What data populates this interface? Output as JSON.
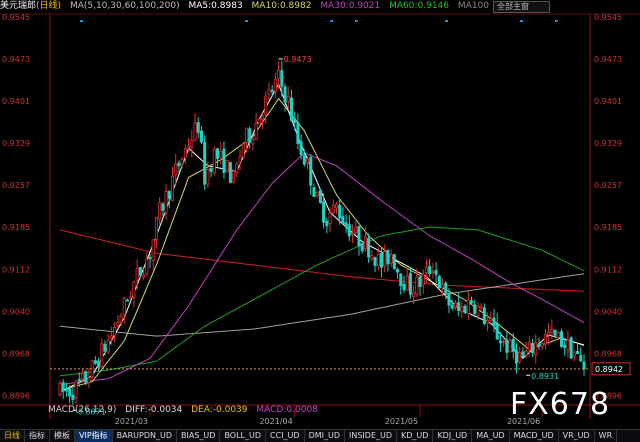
{
  "header": {
    "pair": "美元瑞郎",
    "period": "日线",
    "ma_params": "MA(5,10,30,60,100,200)",
    "ma5": "MA5:0.8983",
    "ma10": "MA10:0.8982",
    "ma30": "MA30:0.9021",
    "ma60": "MA60:0.9146",
    "ma100": "MA100",
    "selector": "全部主窗"
  },
  "macd_header": {
    "name": "MACD(26,12,9)",
    "diff": "DIFF:-0.0034",
    "dea": "DEA:-0.0039",
    "macd": "MACD:0.0008"
  },
  "toolbar": {
    "tabs": [
      "日线",
      "指标",
      "模板",
      "VIP指标",
      "BARUPDN_UD",
      "BIAS_UD",
      "BOLL_UD",
      "CCI_UD",
      "DMI_UD",
      "INSIDE_UD",
      "KD_UD",
      "KDJ_UD",
      "MA_UD",
      "MACD_UD",
      "VR_UD",
      "WR"
    ]
  },
  "watermark": "FX678",
  "chart_data": {
    "type": "candlestick",
    "y_ticks": [
      "0.9545",
      "0.9473",
      "0.9401",
      "0.9329",
      "0.9257",
      "0.9185",
      "0.9112",
      "0.9040",
      "0.8968",
      "0.8896"
    ],
    "ylim": [
      0.888,
      0.955
    ],
    "x_labels": [
      "2021/03",
      "2021/04",
      "2021/05",
      "2021/06"
    ],
    "x_label_candle_index": [
      28,
      73,
      112,
      150
    ],
    "annotations": {
      "high": {
        "label": "0.9473",
        "value": 0.9473,
        "candle": 68
      },
      "low_left": {
        "label": "0.8871",
        "value": 0.8871,
        "candle": 4
      },
      "low_right": {
        "label": "0.8931",
        "value": 0.8931,
        "candle": 145
      }
    },
    "current_price": {
      "label": "0.8942",
      "value": 0.8942
    },
    "candle_count": 164,
    "anchors": [
      [
        0,
        0.8902
      ],
      [
        4,
        0.8905
      ],
      [
        8,
        0.8925
      ],
      [
        12,
        0.896
      ],
      [
        16,
        0.9
      ],
      [
        20,
        0.905
      ],
      [
        24,
        0.91
      ],
      [
        28,
        0.914
      ],
      [
        31,
        0.921
      ],
      [
        34,
        0.925
      ],
      [
        36,
        0.928
      ],
      [
        40,
        0.933
      ],
      [
        43,
        0.936
      ],
      [
        45,
        0.927
      ],
      [
        48,
        0.931
      ],
      [
        51,
        0.9295
      ],
      [
        54,
        0.9265
      ],
      [
        57,
        0.933
      ],
      [
        60,
        0.935
      ],
      [
        63,
        0.939
      ],
      [
        66,
        0.942
      ],
      [
        68,
        0.944
      ],
      [
        71,
        0.94
      ],
      [
        74,
        0.933
      ],
      [
        77,
        0.929
      ],
      [
        80,
        0.923
      ],
      [
        83,
        0.92
      ],
      [
        86,
        0.922
      ],
      [
        89,
        0.919
      ],
      [
        92,
        0.917
      ],
      [
        96,
        0.915
      ],
      [
        100,
        0.912
      ],
      [
        103,
        0.914
      ],
      [
        106,
        0.91
      ],
      [
        109,
        0.908
      ],
      [
        112,
        0.909
      ],
      [
        116,
        0.912
      ],
      [
        120,
        0.906
      ],
      [
        124,
        0.904
      ],
      [
        128,
        0.906
      ],
      [
        132,
        0.903
      ],
      [
        136,
        0.9
      ],
      [
        140,
        0.8975
      ],
      [
        144,
        0.896
      ],
      [
        148,
        0.8985
      ],
      [
        152,
        0.9
      ],
      [
        156,
        0.899
      ],
      [
        160,
        0.897
      ],
      [
        163,
        0.8942
      ]
    ],
    "ma_lines": [
      {
        "name": "MA200",
        "color": "#d02020",
        "points": [
          [
            0,
            0.918
          ],
          [
            30,
            0.914
          ],
          [
            60,
            0.912
          ],
          [
            90,
            0.91
          ],
          [
            120,
            0.9085
          ],
          [
            163,
            0.9075
          ]
        ]
      },
      {
        "name": "MA100",
        "color": "#a0a0a0",
        "points": [
          [
            0,
            0.9015
          ],
          [
            30,
            0.8998
          ],
          [
            60,
            0.901
          ],
          [
            90,
            0.9035
          ],
          [
            120,
            0.907
          ],
          [
            163,
            0.9105
          ]
        ]
      },
      {
        "name": "MA60",
        "color": "#20a020",
        "points": [
          [
            0,
            0.893
          ],
          [
            15,
            0.894
          ],
          [
            30,
            0.8955
          ],
          [
            45,
            0.9015
          ],
          [
            60,
            0.906
          ],
          [
            80,
            0.912
          ],
          [
            100,
            0.917
          ],
          [
            115,
            0.9185
          ],
          [
            130,
            0.918
          ],
          [
            150,
            0.9145
          ],
          [
            163,
            0.911
          ]
        ]
      },
      {
        "name": "MA30",
        "color": "#c040c0",
        "points": [
          [
            0,
            0.8915
          ],
          [
            15,
            0.8925
          ],
          [
            28,
            0.896
          ],
          [
            40,
            0.905
          ],
          [
            55,
            0.918
          ],
          [
            66,
            0.926
          ],
          [
            76,
            0.9312
          ],
          [
            86,
            0.929
          ],
          [
            100,
            0.923
          ],
          [
            115,
            0.917
          ],
          [
            128,
            0.913
          ],
          [
            140,
            0.909
          ],
          [
            152,
            0.9055
          ],
          [
            163,
            0.9021
          ]
        ]
      },
      {
        "name": "MA10",
        "color": "#d8d860",
        "points": [
          [
            0,
            0.8905
          ],
          [
            10,
            0.892
          ],
          [
            20,
            0.899
          ],
          [
            30,
            0.912
          ],
          [
            40,
            0.927
          ],
          [
            50,
            0.93
          ],
          [
            60,
            0.934
          ],
          [
            68,
            0.9405
          ],
          [
            76,
            0.935
          ],
          [
            86,
            0.924
          ],
          [
            96,
            0.917
          ],
          [
            106,
            0.912
          ],
          [
            116,
            0.909
          ],
          [
            126,
            0.906
          ],
          [
            136,
            0.902
          ],
          [
            146,
            0.8975
          ],
          [
            156,
            0.8995
          ],
          [
            163,
            0.8982
          ]
        ]
      },
      {
        "name": "MA5",
        "color": "#ffffff",
        "points": [
          [
            0,
            0.8902
          ],
          [
            10,
            0.893
          ],
          [
            20,
            0.903
          ],
          [
            30,
            0.917
          ],
          [
            40,
            0.932
          ],
          [
            46,
            0.929
          ],
          [
            55,
            0.928
          ],
          [
            62,
            0.937
          ],
          [
            68,
            0.943
          ],
          [
            74,
            0.934
          ],
          [
            84,
            0.921
          ],
          [
            94,
            0.916
          ],
          [
            104,
            0.913
          ],
          [
            114,
            0.91
          ],
          [
            124,
            0.9045
          ],
          [
            134,
            0.902
          ],
          [
            144,
            0.896
          ],
          [
            152,
            0.9
          ],
          [
            163,
            0.8983
          ]
        ]
      }
    ]
  }
}
